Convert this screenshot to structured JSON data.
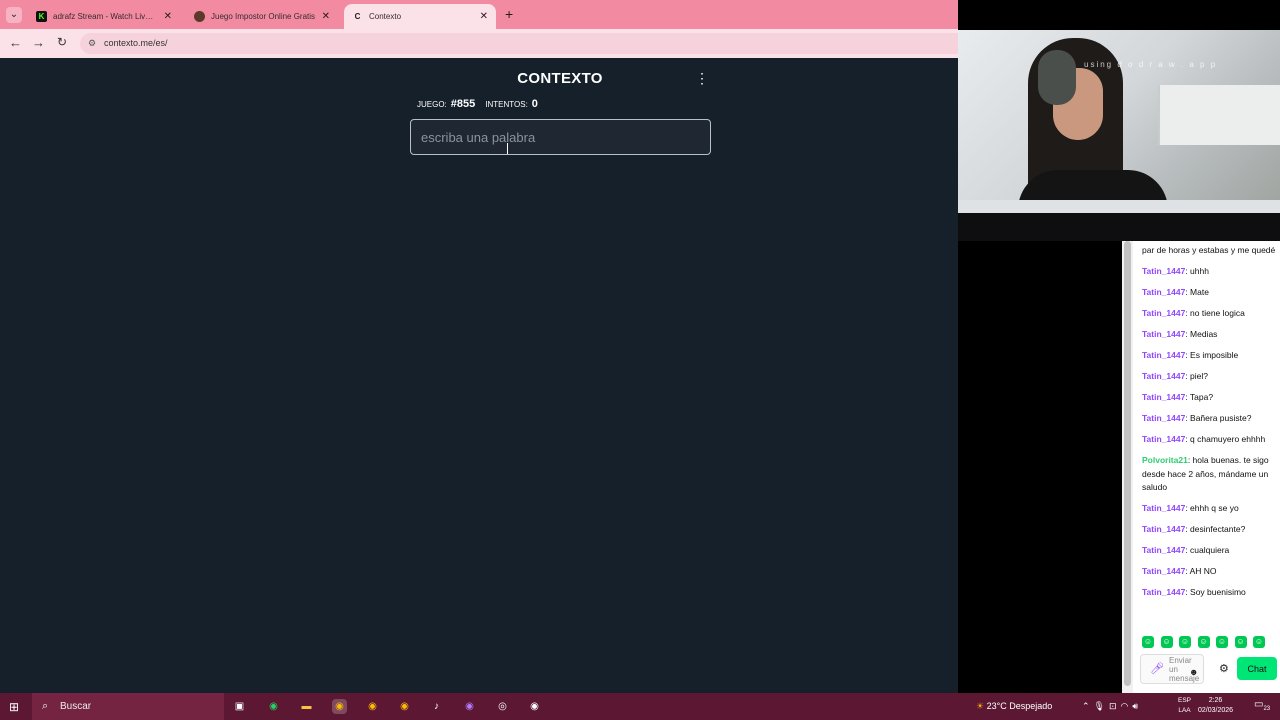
{
  "browser": {
    "tabs": [
      {
        "title": "adrafz Stream - Watch Live on",
        "favicon": "K",
        "favicon_color": "#53fc18",
        "active": false
      },
      {
        "title": "Juego Impostor Online Gratis",
        "favicon": "●",
        "favicon_color": "#5b3a2a",
        "active": false
      },
      {
        "title": "Contexto",
        "favicon": "C",
        "favicon_color": "#ffffff",
        "active": true
      }
    ],
    "url": "contexto.me/es/",
    "chrome_color": "#f28ba2"
  },
  "game": {
    "title": "CONTEXTO",
    "game_label": "JUEGO:",
    "game_number": "#855",
    "attempts_label": "INTENTOS:",
    "attempts": "0",
    "input_placeholder": "escriba una palabra",
    "background": "#15202b"
  },
  "webcam": {
    "watermark": "using  d  o  d  r  a  w  .  a  p  p"
  },
  "chat": {
    "messages": [
      {
        "user": "",
        "text": "par de horas y estabas y me quedé",
        "color": "#9147ff"
      },
      {
        "user": "Tatin_1447",
        "text": ": uhhh",
        "color": "#9147ff"
      },
      {
        "user": "Tatin_1447",
        "text": ": Mate",
        "color": "#9147ff"
      },
      {
        "user": "Tatin_1447",
        "text": ": no tiene logica",
        "color": "#9147ff"
      },
      {
        "user": "Tatin_1447",
        "text": ": Medias",
        "color": "#9147ff"
      },
      {
        "user": "Tatin_1447",
        "text": ": Es imposible",
        "color": "#9147ff"
      },
      {
        "user": "Tatin_1447",
        "text": ": piel?",
        "color": "#9147ff"
      },
      {
        "user": "Tatin_1447",
        "text": ": Tapa?",
        "color": "#9147ff"
      },
      {
        "user": "Tatin_1447",
        "text": ": Bañera pusiste?",
        "color": "#9147ff"
      },
      {
        "user": "Tatin_1447",
        "text": ": q chamuyero ehhhh",
        "color": "#9147ff"
      },
      {
        "user": "Polvorita21",
        "text": ": hola buenas. te sigo desde hace 2 años, mándame un saludo",
        "color": "#2ecc71"
      },
      {
        "user": "Tatin_1447",
        "text": ": ehhh q se yo",
        "color": "#9147ff"
      },
      {
        "user": "Tatin_1447",
        "text": ": desinfectante?",
        "color": "#9147ff"
      },
      {
        "user": "Tatin_1447",
        "text": ": cualquiera",
        "color": "#9147ff"
      },
      {
        "user": "Tatin_1447",
        "text": ": AH NO",
        "color": "#9147ff"
      },
      {
        "user": "Tatin_1447",
        "text": ": Soy buenisimo",
        "color": "#9147ff"
      }
    ],
    "emote_count": 7,
    "input_placeholder": "Enviar un mensaje",
    "send_label": "Chat"
  },
  "taskbar": {
    "search_placeholder": "Buscar",
    "weather": "23°C  Despejado",
    "lang_top": "ESP",
    "lang_bottom": "LAA",
    "time": "2:26",
    "date": "02/03/2026",
    "notif_count": "23"
  }
}
